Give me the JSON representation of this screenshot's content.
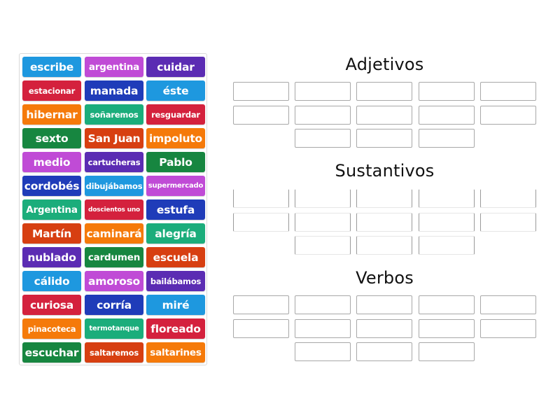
{
  "tiles": {
    "items": [
      {
        "label": "escribe",
        "color": "#1e98df",
        "size": "sz-l"
      },
      {
        "label": "argentina",
        "color": "#c04bd6",
        "size": "sz-m"
      },
      {
        "label": "cuidar",
        "color": "#5b2cb3",
        "size": "sz-l"
      },
      {
        "label": "estacionar",
        "color": "#d4213d",
        "size": "sz-s"
      },
      {
        "label": "manada",
        "color": "#1f3cb9",
        "size": "sz-l"
      },
      {
        "label": "éste",
        "color": "#1e98df",
        "size": "sz-l"
      },
      {
        "label": "hibernar",
        "color": "#f57a0a",
        "size": "sz-l"
      },
      {
        "label": "soñaremos",
        "color": "#1bad7b",
        "size": "sz-s"
      },
      {
        "label": "resguardar",
        "color": "#d4213d",
        "size": "sz-s"
      },
      {
        "label": "sexto",
        "color": "#178640",
        "size": "sz-l"
      },
      {
        "label": "San Juan",
        "color": "#d73f11",
        "size": "sz-l"
      },
      {
        "label": "impoluto",
        "color": "#f57a0a",
        "size": "sz-l"
      },
      {
        "label": "medio",
        "color": "#c04bd6",
        "size": "sz-l"
      },
      {
        "label": "cartucheras",
        "color": "#5b2cb3",
        "size": "sz-s"
      },
      {
        "label": "Pablo",
        "color": "#178640",
        "size": "sz-l"
      },
      {
        "label": "cordobés",
        "color": "#1f3cb9",
        "size": "sz-l"
      },
      {
        "label": "dibujábamos",
        "color": "#1e98df",
        "size": "sz-s"
      },
      {
        "label": "supermercado",
        "color": "#c04bd6",
        "size": "sz-xs"
      },
      {
        "label": "Argentina",
        "color": "#1bad7b",
        "size": "sz-m"
      },
      {
        "label": "doscientos uno",
        "color": "#d4213d",
        "size": "sz-xxs"
      },
      {
        "label": "estufa",
        "color": "#1f3cb9",
        "size": "sz-l"
      },
      {
        "label": "Martín",
        "color": "#d73f11",
        "size": "sz-l"
      },
      {
        "label": "caminará",
        "color": "#f57a0a",
        "size": "sz-l"
      },
      {
        "label": "alegría",
        "color": "#1bad7b",
        "size": "sz-l"
      },
      {
        "label": "nublado",
        "color": "#5b2cb3",
        "size": "sz-l"
      },
      {
        "label": "cardumen",
        "color": "#178640",
        "size": "sz-m"
      },
      {
        "label": "escuela",
        "color": "#d73f11",
        "size": "sz-l"
      },
      {
        "label": "cálido",
        "color": "#1e98df",
        "size": "sz-l"
      },
      {
        "label": "amoroso",
        "color": "#c04bd6",
        "size": "sz-l"
      },
      {
        "label": "bailábamos",
        "color": "#5b2cb3",
        "size": "sz-s"
      },
      {
        "label": "curiosa",
        "color": "#d4213d",
        "size": "sz-l"
      },
      {
        "label": "corría",
        "color": "#1f3cb9",
        "size": "sz-l"
      },
      {
        "label": "miré",
        "color": "#1e98df",
        "size": "sz-l"
      },
      {
        "label": "pinacoteca",
        "color": "#f57a0a",
        "size": "sz-s"
      },
      {
        "label": "termotanque",
        "color": "#1bad7b",
        "size": "sz-xs"
      },
      {
        "label": "floreado",
        "color": "#d4213d",
        "size": "sz-l"
      },
      {
        "label": "escuchar",
        "color": "#178640",
        "size": "sz-l"
      },
      {
        "label": "saltaremos",
        "color": "#d73f11",
        "size": "sz-s"
      },
      {
        "label": "saltarines",
        "color": "#f57a0a",
        "size": "sz-m"
      }
    ]
  },
  "groups": [
    {
      "title": "Adjetivos",
      "slot_count": 13
    },
    {
      "title": "Sustantivos",
      "slot_count": 13
    },
    {
      "title": "Verbos",
      "slot_count": 13
    }
  ]
}
